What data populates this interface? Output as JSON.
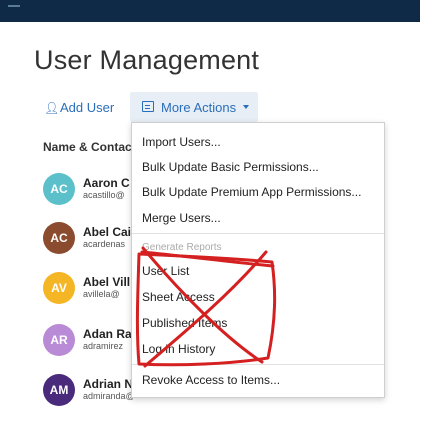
{
  "page": {
    "title": "User Management"
  },
  "toolbar": {
    "add_user_label": "Add User",
    "more_actions_label": "More Actions"
  },
  "table": {
    "column_header": "Name & Contact"
  },
  "users": [
    {
      "initials": "AC",
      "name": "Aaron C",
      "email": "acastillo@",
      "color": "#5bc0c9"
    },
    {
      "initials": "AC",
      "name": "Abel Cai",
      "email": "acardenas",
      "color": "#8b4b2f"
    },
    {
      "initials": "AV",
      "name": "Abel Vill",
      "email": "avillela@",
      "color": "#f5b625"
    },
    {
      "initials": "AR",
      "name": "Adan Ra",
      "email": "adramirez",
      "color": "#b98bd6"
    },
    {
      "initials": "AM",
      "name": "Adrian N",
      "email": "admiranda@",
      "color": "#4a2a7a"
    }
  ],
  "menu": {
    "items_top": [
      "Import Users...",
      "Bulk Update Basic Permissions...",
      "Bulk Update Premium App Permissions...",
      "Merge Users..."
    ],
    "section_header": "Generate Reports",
    "reports": [
      "User List",
      "Sheet Access",
      "Published Items",
      "Log in History"
    ],
    "items_bottom": [
      "Revoke Access to Items..."
    ]
  },
  "colors": {
    "topbar": "#0e2a47",
    "accent": "#2a6ebb",
    "annotation": "#d42020"
  },
  "icons": {
    "add_user": "add-user-icon",
    "more_actions": "more-actions-icon",
    "caret": "caret-down-icon"
  }
}
